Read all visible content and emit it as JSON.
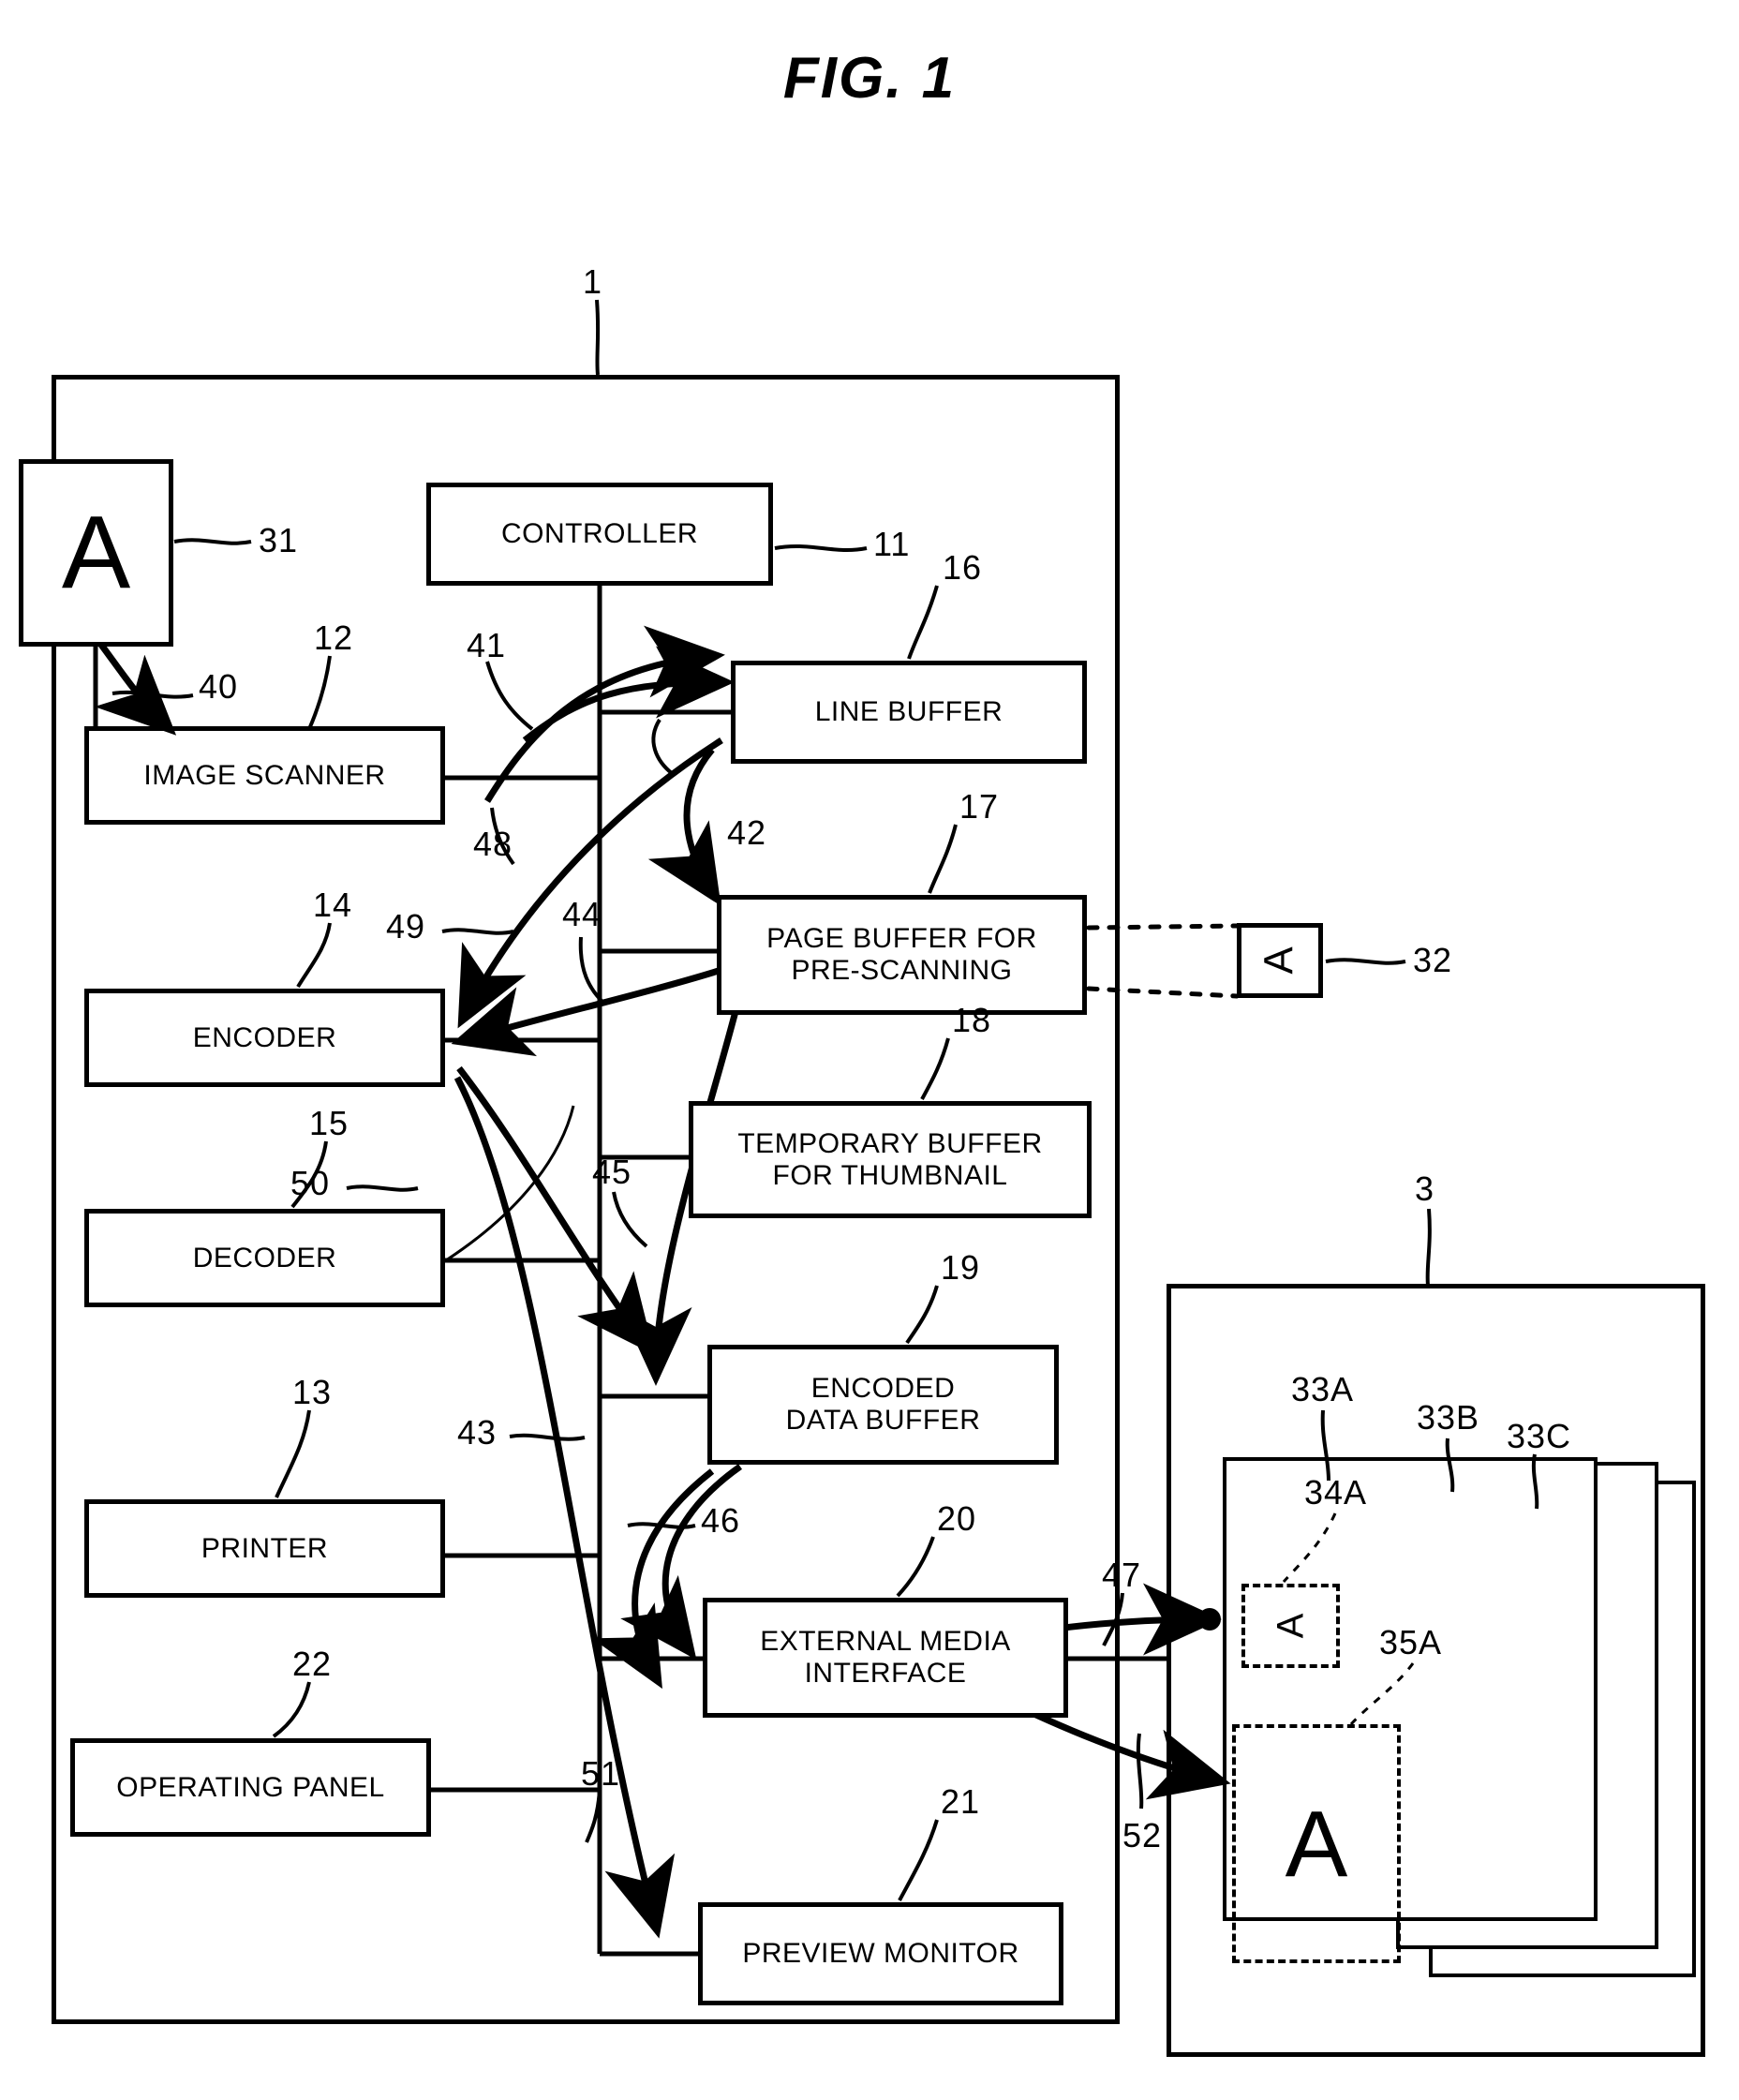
{
  "figure": {
    "title": "FIG. 1",
    "system_label": "1",
    "external_media_label": "3"
  },
  "blocks": [
    {
      "id": "controller",
      "label": "CONTROLLER",
      "ref": "11"
    },
    {
      "id": "image-scanner",
      "label": "IMAGE SCANNER",
      "ref": "12"
    },
    {
      "id": "printer",
      "label": "PRINTER",
      "ref": "13"
    },
    {
      "id": "encoder",
      "label": "ENCODER",
      "ref": "14"
    },
    {
      "id": "decoder",
      "label": "DECODER",
      "ref": "15"
    },
    {
      "id": "line-buffer",
      "label": "LINE BUFFER",
      "ref": "16"
    },
    {
      "id": "page-buffer",
      "label": "PAGE BUFFER FOR PRE-SCANNING",
      "ref": "17"
    },
    {
      "id": "temporary-buffer",
      "label": "TEMPORARY BUFFER FOR THUMBNAIL",
      "ref": "18"
    },
    {
      "id": "encoded-data-buffer",
      "label": "ENCODED DATA BUFFER",
      "ref": "19"
    },
    {
      "id": "external-media-interface",
      "label": "EXTERNAL MEDIA INTERFACE",
      "ref": "20"
    },
    {
      "id": "preview-monitor",
      "label": "PREVIEW MONITOR",
      "ref": "21"
    },
    {
      "id": "operating-panel",
      "label": "OPERATING PANEL",
      "ref": "22"
    }
  ],
  "block_labels": {
    "controller": "CONTROLLER",
    "image_scanner": "IMAGE SCANNER",
    "printer": "PRINTER",
    "encoder": "ENCODER",
    "decoder": "DECODER",
    "line_buffer": "LINE BUFFER",
    "page_buffer_l1": "PAGE BUFFER FOR",
    "page_buffer_l2": "PRE-SCANNING",
    "temporary_buffer_l1": "TEMPORARY BUFFER",
    "temporary_buffer_l2": "FOR THUMBNAIL",
    "encoded_data_buffer_l1": "ENCODED",
    "encoded_data_buffer_l2": "DATA BUFFER",
    "external_media_interface_l1": "EXTERNAL MEDIA",
    "external_media_interface_l2": "INTERFACE",
    "preview_monitor": "PREVIEW MONITOR",
    "operating_panel": "OPERATING PANEL"
  },
  "refs": {
    "system": "1",
    "external_media": "3",
    "controller": "11",
    "image_scanner": "12",
    "printer": "13",
    "encoder": "14",
    "decoder": "15",
    "line_buffer": "16",
    "page_buffer": "17",
    "temporary_buffer": "18",
    "encoded_data_buffer": "19",
    "external_media_interface": "20",
    "preview_monitor": "21",
    "operating_panel": "22",
    "original_document": "31",
    "prescan_image": "32",
    "sheet_a": "33A",
    "sheet_b": "33B",
    "sheet_c": "33C",
    "thumbnail_a": "34A",
    "image_a": "35A",
    "flow_40": "40",
    "flow_41": "41",
    "flow_42": "42",
    "flow_43": "43",
    "flow_44": "44",
    "flow_45": "45",
    "flow_46": "46",
    "flow_47": "47",
    "flow_48": "48",
    "flow_49": "49",
    "flow_50": "50",
    "flow_51": "51",
    "flow_52": "52"
  },
  "documents": {
    "original_glyph": "A",
    "prescan_glyph": "A",
    "thumbnail_glyph": "A",
    "page_image_glyph": "A"
  },
  "colors": {
    "ink": "#000000",
    "paper": "#ffffff"
  }
}
